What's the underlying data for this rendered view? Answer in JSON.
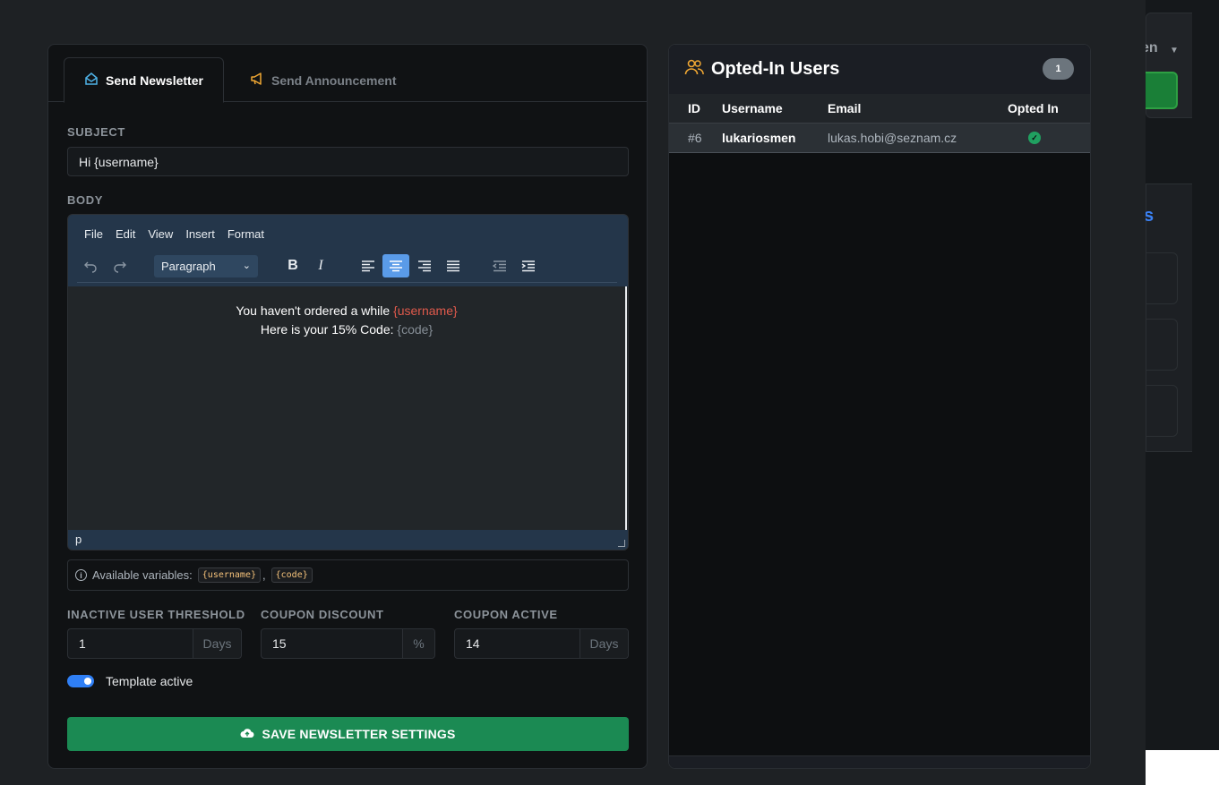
{
  "background": {
    "partial_text": "en",
    "partial_blue_text": "s"
  },
  "tabs": [
    {
      "label": "Send Newsletter",
      "icon": "envelope-open-icon",
      "active": true
    },
    {
      "label": "Send Announcement",
      "icon": "megaphone-icon",
      "active": false
    }
  ],
  "subject": {
    "label": "SUBJECT",
    "value": "Hi {username}"
  },
  "body": {
    "label": "BODY",
    "menu": [
      "File",
      "Edit",
      "View",
      "Insert",
      "Format"
    ],
    "block_format": "Paragraph",
    "content": {
      "line1_text": "You haven't ordered a while ",
      "line1_var": "{username}",
      "line2_text": "Here is your 15% Code: ",
      "line2_var": "{code}"
    },
    "status_path": "p"
  },
  "variables": {
    "prefix": "Available variables:",
    "items": [
      "{username}",
      "{code}"
    ],
    "separator": ","
  },
  "settings": {
    "inactive_threshold": {
      "label": "INACTIVE USER THRESHOLD",
      "value": "1",
      "unit": "Days"
    },
    "coupon_discount": {
      "label": "COUPON DISCOUNT",
      "value": "15",
      "unit": "%"
    },
    "coupon_active": {
      "label": "COUPON ACTIVE",
      "value": "14",
      "unit": "Days"
    }
  },
  "template_toggle": {
    "label": "Template active",
    "on": true
  },
  "save_button": {
    "label": "SAVE NEWSLETTER SETTINGS"
  },
  "opted_in": {
    "title": "Opted-In Users",
    "count": "1",
    "columns": [
      "ID",
      "Username",
      "Email",
      "Opted In"
    ],
    "rows": [
      {
        "id": "#6",
        "username": "lukariosmen",
        "email": "lukas.hobi@seznam.cz",
        "opted_in": true
      }
    ]
  },
  "colors": {
    "accent_blue": "#2f7ff5",
    "save_green": "#1b8a53",
    "variable_red": "#e05a4c",
    "icon_orange": "#f0a733"
  }
}
